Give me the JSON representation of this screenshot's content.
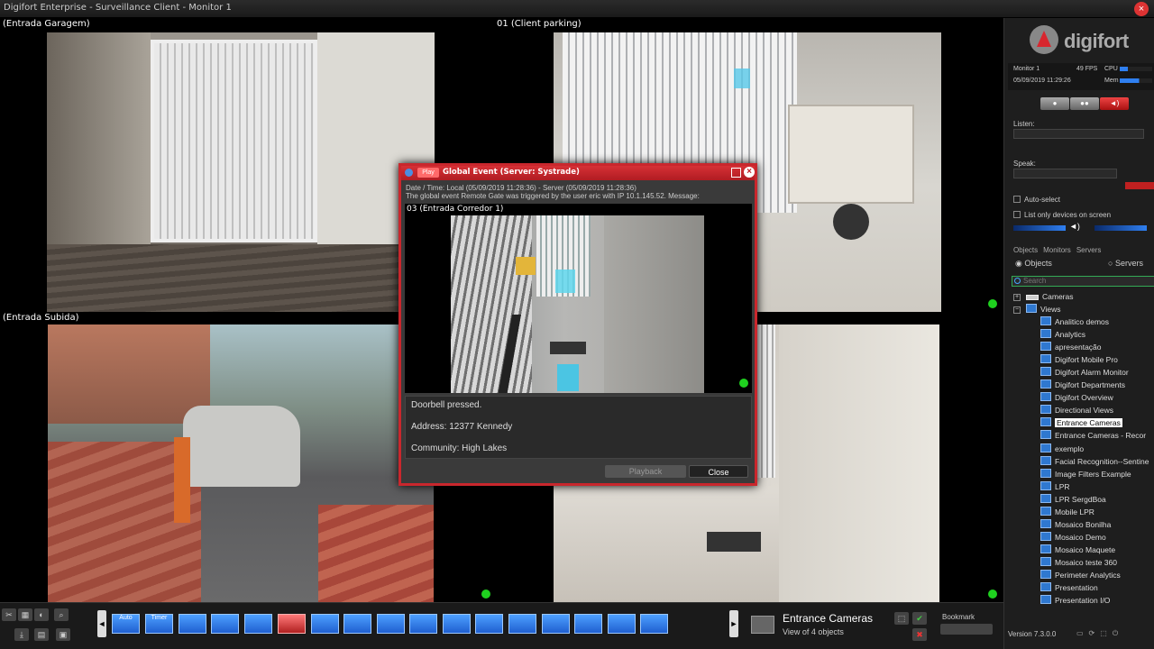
{
  "window": {
    "title": "Digifort Enterprise - Surveillance Client - Monitor 1"
  },
  "cameras": [
    {
      "label": "(Entrada Garagem)"
    },
    {
      "label": "01 (Client parking)"
    },
    {
      "label": "(Entrada Subida)"
    },
    {
      "label": ""
    }
  ],
  "dialog": {
    "play_label": "Play",
    "title": "Global Event (Server: Systrade)",
    "meta_line1": "Date / Time: Local (05/09/2019 11:28:36) - Server (05/09/2019 11:28:36)",
    "meta_line2": "The global event Remote Gate was triggered by the user eric with IP 10.1.145.52. Message:",
    "video_label": "03 (Entrada Corredor 1)",
    "message_lines": [
      "Doorbell pressed.",
      "Address: 12377 Kennedy",
      "Community: High Lakes"
    ],
    "playback_label": "Playback",
    "close_label": "Close"
  },
  "panel": {
    "logo_text": "digifort",
    "monitor": "Monitor 1",
    "fps": "49 FPS",
    "cpu_label": "CPU",
    "datetime": "05/09/2019 11:29:26",
    "mem_label": "Mem",
    "listen_label": "Listen:",
    "speak_label": "Speak:",
    "auto_select": "Auto-select",
    "list_only": "List only devices on screen",
    "tabs": [
      "Objects",
      "Monitors",
      "Servers"
    ],
    "radio_objects": "Objects",
    "radio_servers": "Servers",
    "search_placeholder": "Search",
    "tree_root_cameras": "Cameras",
    "tree_root_views": "Views",
    "views": [
      "Analitico demos",
      "Analytics",
      "apresentação",
      "Digifort  Mobile Pro",
      "Digifort Alarm Monitor",
      "Digifort Departments",
      "Digifort Overview",
      "Directional Views",
      "Entrance Cameras",
      "Entrance Cameras - Recor",
      "exemplo",
      "Facial Recognition--Sentine",
      "Image Filters Example",
      "LPR",
      "LPR SergdBoa",
      "Mobile LPR",
      "Mosaico Bonilha",
      "Mosaico Demo",
      "Mosaico Maquete",
      "Mosaico teste 360",
      "Perimeter Analytics",
      "Presentation",
      "Presentation I/O"
    ],
    "selected_view": "Entrance Cameras",
    "version": "Version 7.3.0.0"
  },
  "toolbar": {
    "layout_auto": "Auto",
    "layout_timer": "Timer",
    "view_name": "Entrance Cameras",
    "view_count": "View of 4 objects",
    "bookmark_label": "Bookmark"
  }
}
